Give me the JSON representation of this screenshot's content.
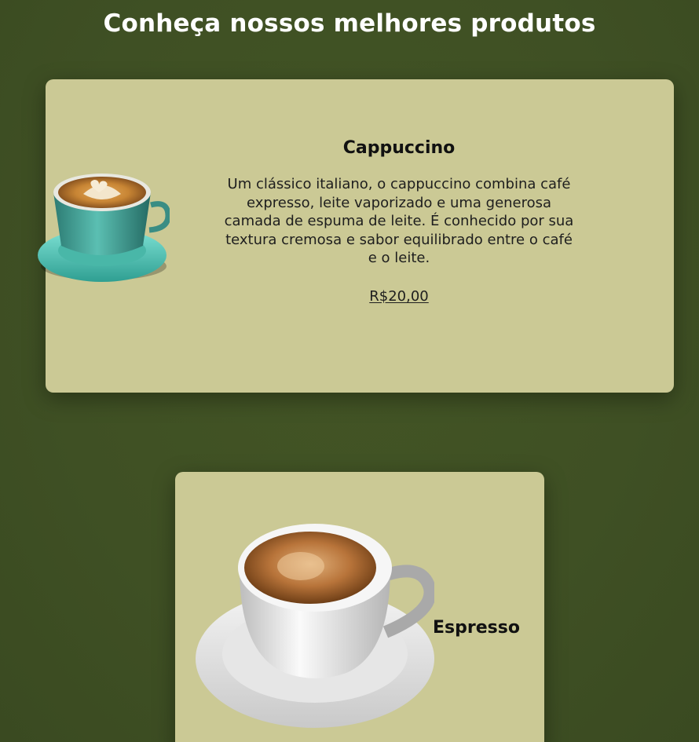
{
  "page": {
    "heading": "Conheça nossos melhores produtos"
  },
  "products": [
    {
      "name": "Cappuccino",
      "description": "Um clássico italiano, o cappuccino combina café expresso, leite vaporizado e uma generosa camada de espuma de leite. É conhecido por sua textura cremosa e sabor equilibrado entre o café e o leite.",
      "price": "R$20,00",
      "image": "cappuccino-cup-turquoise-image"
    },
    {
      "name": "Espresso",
      "image": "espresso-cup-white-image"
    }
  ],
  "colors": {
    "background": "#405125",
    "card": "#cbc995",
    "heading_text": "#ffffff",
    "body_text": "#1e1e1e"
  }
}
